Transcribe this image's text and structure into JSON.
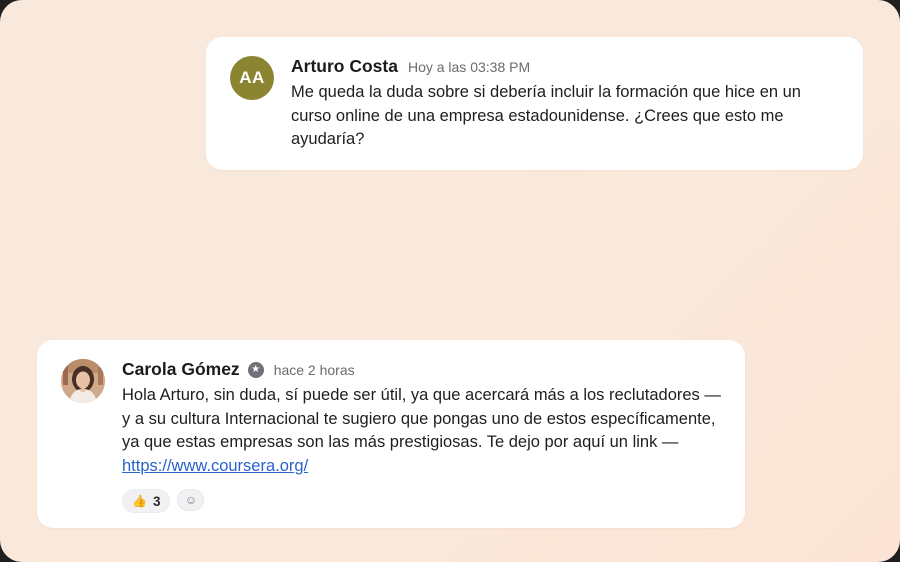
{
  "messages": [
    {
      "author": "Arturo Costa",
      "initials": "AA",
      "avatar_color": "#8b8531",
      "timestamp": "Hoy a las 03:38 PM",
      "text": "Me queda la duda sobre si debería incluir la formación que hice en un curso online de una empresa estadounidense. ¿Crees que esto me ayudaría?"
    },
    {
      "author": "Carola Gómez",
      "badge_icon": "star-icon",
      "timestamp": "hace 2 horas",
      "text": "Hola Arturo, sin duda, sí puede ser útil, ya que acercará más a los reclutadores — y a su cultura Internacional te sugiero que pongas uno de estos específicamente, ya que estas empresas son las más prestigiosas. Te dejo por aquí un link — ",
      "link": "https://www.coursera.org/",
      "reactions": [
        {
          "icon": "thumbs-up-icon",
          "count": "3"
        }
      ],
      "add_reaction_icon": "smiley-icon"
    }
  ],
  "colors": {
    "background": "#f8e9dc",
    "card": "#ffffff",
    "link": "#2a63c9"
  }
}
